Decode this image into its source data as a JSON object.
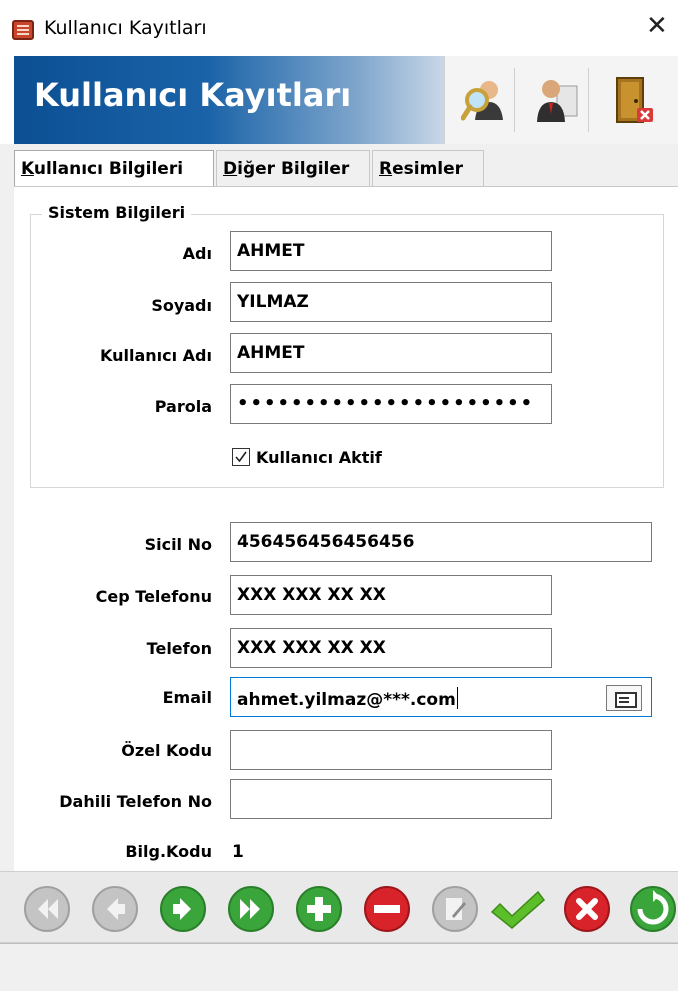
{
  "window": {
    "title": "Kullanıcı Kayıtları",
    "close_icon": "close-icon"
  },
  "banner": {
    "title": "Kullanıcı Kayıtları",
    "tools": [
      "search-user-icon",
      "user-edit-icon",
      "exit-door-icon"
    ]
  },
  "tabs": [
    {
      "label_u": "K",
      "label_rest": "ullanıcı Bilgileri",
      "active": true
    },
    {
      "label_u": "D",
      "label_rest": "iğer Bilgiler",
      "active": false
    },
    {
      "label_u": "R",
      "label_rest": "esimler",
      "active": false
    }
  ],
  "system_group": {
    "legend": "Sistem Bilgileri",
    "adi_label": "Adı",
    "adi_value": "AHMET",
    "soyadi_label": "Soyadı",
    "soyadi_value": "YILMAZ",
    "kullanici_adi_label": "Kullanıcı Adı",
    "kullanici_adi_value": "AHMET",
    "parola_label": "Parola",
    "parola_value": "••••••••••••••••••••••",
    "aktif_label": "Kullanıcı Aktif",
    "aktif_checked": true
  },
  "details": {
    "sicil_label": "Sicil No",
    "sicil_value": "456456456456456",
    "cep_label": "Cep Telefonu",
    "cep_value": "XXX XXX XX XX",
    "telefon_label": "Telefon",
    "telefon_value": "XXX XXX XX XX",
    "email_label": "Email",
    "email_value": "ahmet.yilmaz@***.com",
    "ozel_label": "Özel Kodu",
    "ozel_value": "",
    "dahili_label": "Dahili Telefon No",
    "dahili_value": "",
    "bilg_label": "Bilg.Kodu",
    "bilg_value": "1"
  },
  "colors": {
    "banner_blue": "#0c4f93",
    "nav_green": "#3aa53a",
    "nav_red": "#d8232a",
    "nav_gray": "#b9b9b9"
  },
  "navbar": {
    "buttons": [
      "first-record-icon",
      "previous-record-icon",
      "next-record-icon",
      "last-record-icon",
      "add-record-icon",
      "delete-record-icon",
      "edit-record-icon",
      "save-check-icon",
      "cancel-icon",
      "refresh-icon"
    ]
  }
}
